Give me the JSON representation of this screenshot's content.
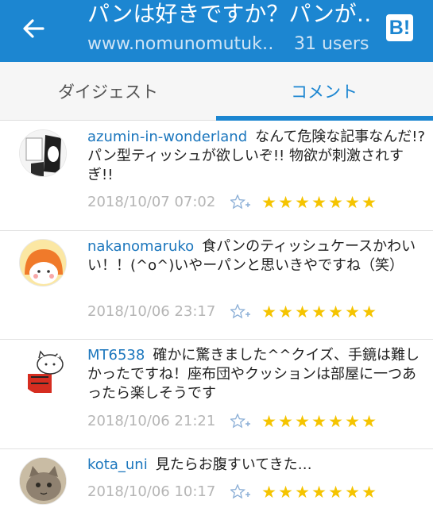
{
  "header": {
    "title": "パンは好きですか？パンが…",
    "url": "www.nomunomutuk…",
    "users": "31 users",
    "brand_glyph": "B!",
    "icons": {
      "back": "arrow-left-icon",
      "brand": "hatena-bookmark-icon"
    },
    "colors": {
      "appbar": "#1c86d1",
      "accent": "#1c86d1",
      "star": "#f5c400"
    }
  },
  "tabs": [
    {
      "label": "ダイジェスト",
      "active": false
    },
    {
      "label": "コメント",
      "active": true
    }
  ],
  "comments": [
    {
      "user": "azumin-in-wonderland",
      "text": "なんて危険な記事なんだ!? パン型ティッシュが欲しいぞ!!  物欲が刺激されすぎ!!",
      "date": "2018/10/07 07:02",
      "stars": 7
    },
    {
      "user": "nakanomaruko",
      "text": "食パンのティッシュケースかわいい！！(^o^)いやーパンと思いきやですね（笑）",
      "date": "2018/10/06 23:17",
      "stars": 7
    },
    {
      "user": "MT6538",
      "text": "確かに驚きました^^クイズ、手鏡は難しかったですね！座布団やクッションは部屋に一つあったら楽しそうです",
      "date": "2018/10/06 21:21",
      "stars": 7
    },
    {
      "user": "kota_uni",
      "text": "見たらお腹すいてきた…",
      "date": "2018/10/06 10:17",
      "stars": 7
    }
  ]
}
